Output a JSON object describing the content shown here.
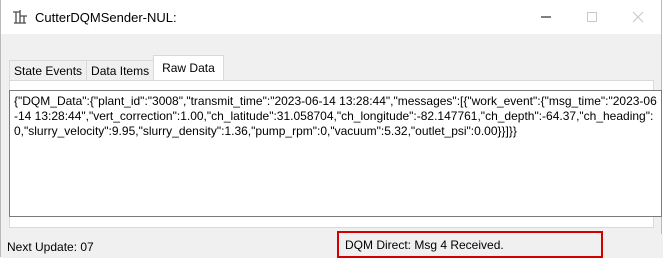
{
  "window": {
    "title": "CutterDQMSender-NUL:",
    "icon": "pipeline-app-icon",
    "controls": {
      "minimize": "minimize",
      "maximize": "maximize",
      "close": "close"
    }
  },
  "tabs": [
    {
      "label": "State Events",
      "active": false
    },
    {
      "label": "Data Items",
      "active": false
    },
    {
      "label": "Raw Data",
      "active": true
    }
  ],
  "raw_data": {
    "text": "{\"DQM_Data\":{\"plant_id\":\"3008\",\"transmit_time\":\"2023-06-14 13:28:44\",\"messages\":[{\"work_event\":{\"msg_time\":\"2023-06-14 13:28:44\",\"vert_correction\":1.00,\"ch_latitude\":31.058704,\"ch_longitude\":-82.147761,\"ch_depth\":-64.37,\"ch_heading\":0,\"slurry_velocity\":9.95,\"slurry_density\":1.36,\"pump_rpm\":0,\"vacuum\":5.32,\"outlet_psi\":0.00}}]}}"
  },
  "status": {
    "next_update": "Next Update: 07",
    "message": "DQM Direct: Msg 4 Received.",
    "highlight_color": "#d40000"
  }
}
